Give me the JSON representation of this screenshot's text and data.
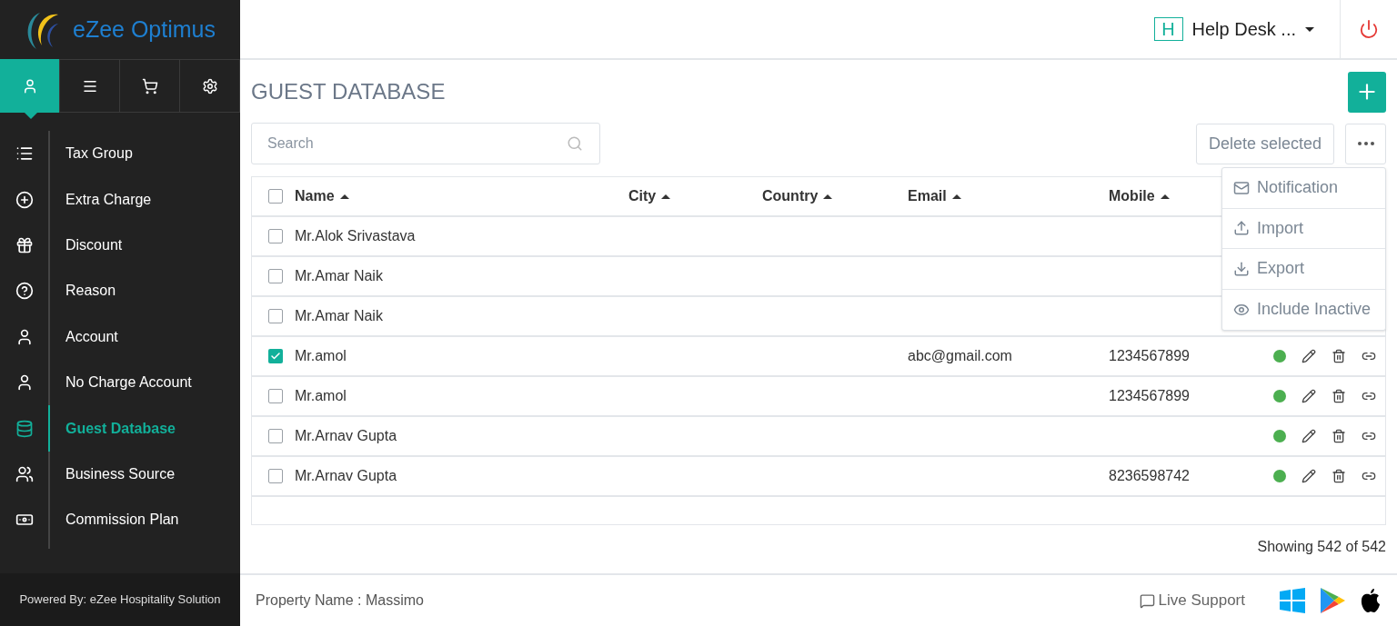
{
  "brand": {
    "name": "eZee Optimus"
  },
  "icon_tabs": [
    {
      "kind": "user",
      "selected": true
    },
    {
      "kind": "menu",
      "selected": false
    },
    {
      "kind": "cart",
      "selected": false
    },
    {
      "kind": "settings",
      "selected": false
    }
  ],
  "sidebar": {
    "items": [
      {
        "label": "Tax Group",
        "kind": "list",
        "selected": false
      },
      {
        "label": "Extra Charge",
        "kind": "plus",
        "selected": false
      },
      {
        "label": "Discount",
        "kind": "gift",
        "selected": false
      },
      {
        "label": "Reason",
        "kind": "question",
        "selected": false
      },
      {
        "label": "Account",
        "kind": "person",
        "selected": false
      },
      {
        "label": "No Charge Account",
        "kind": "person",
        "selected": false
      },
      {
        "label": "Guest Database",
        "kind": "database",
        "selected": true
      },
      {
        "label": "Business Source",
        "kind": "group",
        "selected": false
      },
      {
        "label": "Commission Plan",
        "kind": "money",
        "selected": false
      }
    ],
    "footer": "Powered By: eZee Hospitality Solution"
  },
  "header": {
    "user_initial": "H",
    "user_name": "Help Desk ..."
  },
  "page_title": "GUEST DATABASE",
  "search": {
    "placeholder": "Search"
  },
  "delete_button": "Delete selected",
  "more_menu": {
    "items": [
      {
        "label": "Notification",
        "kind": "mail"
      },
      {
        "label": "Import",
        "kind": "upload"
      },
      {
        "label": "Export",
        "kind": "download"
      },
      {
        "label": "Include Inactive",
        "kind": "eye"
      }
    ]
  },
  "table": {
    "columns": [
      "Name",
      "City",
      "Country",
      "Email",
      "Mobile"
    ],
    "all_checked": false,
    "rows": [
      {
        "checked": false,
        "name": "Mr.Alok Srivastava"
      },
      {
        "checked": false,
        "name": "Mr.Amar Naik"
      },
      {
        "checked": false,
        "name": "Mr.Amar Naik"
      },
      {
        "checked": true,
        "name": "Mr.amol",
        "email": "abc@gmail.com",
        "mobile": "1234567899",
        "active": true
      },
      {
        "checked": false,
        "name": "Mr.amol",
        "mobile": "1234567899",
        "active": true
      },
      {
        "checked": false,
        "name": "Mr.Arnav Gupta",
        "active": true
      },
      {
        "checked": false,
        "name": "Mr.Arnav Gupta",
        "mobile": "8236598742",
        "active": true
      }
    ]
  },
  "showing": "Showing 542 of 542",
  "footer": {
    "property": "Property Name : Massimo",
    "live_support": "Live Support"
  }
}
